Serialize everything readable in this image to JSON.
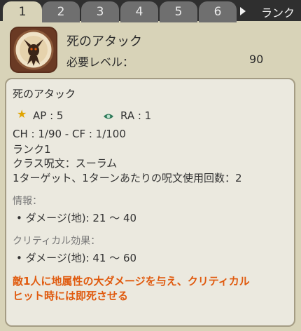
{
  "tabs": [
    {
      "label": "1",
      "active": true
    },
    {
      "label": "2",
      "active": false
    },
    {
      "label": "3",
      "active": false
    },
    {
      "label": "4",
      "active": false
    },
    {
      "label": "5",
      "active": false
    },
    {
      "label": "6",
      "active": false
    }
  ],
  "rank_label": "ランク",
  "header": {
    "title": "死のアタック",
    "level_label": "必要レベル：",
    "level_value": "90"
  },
  "spell": {
    "name": "死のアタック",
    "ap": "AP : 5",
    "ra": "RA : 1",
    "ch_cf": "CH : 1/90 - CF : 1/100",
    "rank": "ランク1",
    "class_spell": "クラス呪文：スーラム",
    "targets": "1ターゲット、1ターンあたりの呪文使用回数：2",
    "info_label": "情報：",
    "damage": "• ダメージ(地): 21 ～ 40",
    "critical_label": "クリティカル効果：",
    "critical_damage": "• ダメージ(地): 41 ～ 60",
    "description_line1": "敵1人に地属性の大ダメージを与え、クリティカル",
    "description_line2": "ヒット時には即死させる"
  },
  "colors": {
    "accent_orange": "#e05a0e",
    "star": "#e0a400",
    "eye": "#2f7a5a",
    "tab_bar": "#2f2f2f",
    "tab_inactive": "#6f6f6f",
    "panel_bg": "#d8d3b8",
    "card_bg": "#ebe9df"
  },
  "icons": {
    "spell": "horned-demon-spell-icon",
    "ap": "star-icon",
    "ra": "eye-icon",
    "next": "arrow-right-icon"
  }
}
